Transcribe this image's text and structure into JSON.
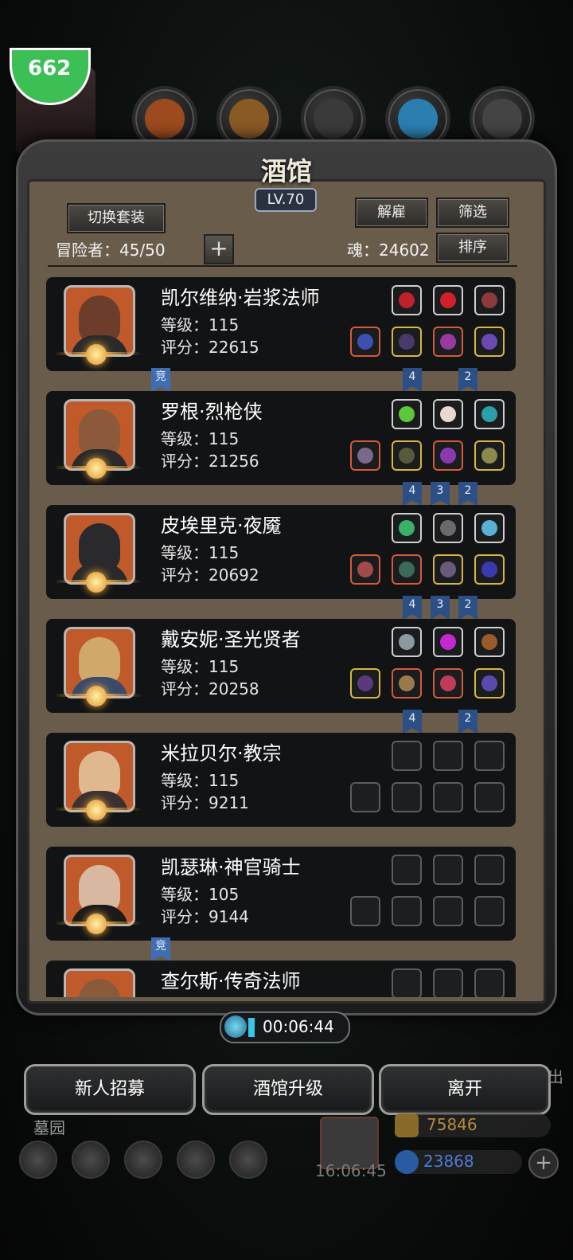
{
  "hud": {
    "badge": "662"
  },
  "header": {
    "title": "酒馆",
    "level": "LV.70",
    "switch_outfit": "切换套装",
    "dismiss": "解雇",
    "filter": "筛选",
    "sort": "排序",
    "adventurers_label": "冒险者：45/50",
    "soul_label": "魂：24602",
    "plus": "+"
  },
  "heroes": [
    {
      "name": "凯尔维纳·岩浆法师",
      "level": "等级：115",
      "score": "评分：22615",
      "ribbons": [
        "竞",
        "4",
        "2"
      ]
    },
    {
      "name": "罗根·烈枪侠",
      "level": "等级：115",
      "score": "评分：21256",
      "ribbons": [
        "4",
        "3",
        "2"
      ]
    },
    {
      "name": "皮埃里克·夜魇",
      "level": "等级：115",
      "score": "评分：20692",
      "ribbons": [
        "4",
        "3",
        "2"
      ]
    },
    {
      "name": "戴安妮·圣光贤者",
      "level": "等级：115",
      "score": "评分：20258",
      "ribbons": [
        "4",
        "2"
      ]
    },
    {
      "name": "米拉贝尔·教宗",
      "level": "等级：115",
      "score": "评分：9211",
      "ribbons": []
    },
    {
      "name": "凯瑟琳·神官骑士",
      "level": "等级：105",
      "score": "评分：9144",
      "ribbons": [
        "竞"
      ]
    },
    {
      "name": "查尔斯·传奇法师",
      "level": "",
      "score": "",
      "ribbons": []
    }
  ],
  "timer": "00:06:44",
  "buttons": {
    "recruit": "新人招募",
    "upgrade": "酒馆升级",
    "leave": "离开"
  },
  "footer": {
    "left_label": "墓园",
    "clock": "16:06:45",
    "gold": "75846",
    "gems": "23868",
    "right_label": "出"
  },
  "colors": {
    "panel": "#6a5c4b",
    "card": "#121315",
    "ribbon": "#2c4f86",
    "gold_text": "#b38a3a",
    "gem_text": "#4e7bd6"
  }
}
